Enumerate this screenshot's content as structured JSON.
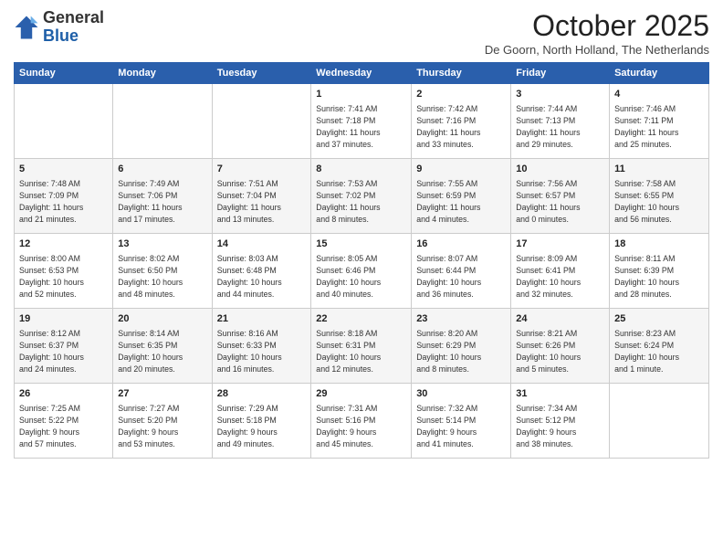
{
  "header": {
    "logo_general": "General",
    "logo_blue": "Blue",
    "month_title": "October 2025",
    "subtitle": "De Goorn, North Holland, The Netherlands"
  },
  "columns": [
    "Sunday",
    "Monday",
    "Tuesday",
    "Wednesday",
    "Thursday",
    "Friday",
    "Saturday"
  ],
  "weeks": [
    [
      {
        "day": "",
        "info": ""
      },
      {
        "day": "",
        "info": ""
      },
      {
        "day": "",
        "info": ""
      },
      {
        "day": "1",
        "info": "Sunrise: 7:41 AM\nSunset: 7:18 PM\nDaylight: 11 hours\nand 37 minutes."
      },
      {
        "day": "2",
        "info": "Sunrise: 7:42 AM\nSunset: 7:16 PM\nDaylight: 11 hours\nand 33 minutes."
      },
      {
        "day": "3",
        "info": "Sunrise: 7:44 AM\nSunset: 7:13 PM\nDaylight: 11 hours\nand 29 minutes."
      },
      {
        "day": "4",
        "info": "Sunrise: 7:46 AM\nSunset: 7:11 PM\nDaylight: 11 hours\nand 25 minutes."
      }
    ],
    [
      {
        "day": "5",
        "info": "Sunrise: 7:48 AM\nSunset: 7:09 PM\nDaylight: 11 hours\nand 21 minutes."
      },
      {
        "day": "6",
        "info": "Sunrise: 7:49 AM\nSunset: 7:06 PM\nDaylight: 11 hours\nand 17 minutes."
      },
      {
        "day": "7",
        "info": "Sunrise: 7:51 AM\nSunset: 7:04 PM\nDaylight: 11 hours\nand 13 minutes."
      },
      {
        "day": "8",
        "info": "Sunrise: 7:53 AM\nSunset: 7:02 PM\nDaylight: 11 hours\nand 8 minutes."
      },
      {
        "day": "9",
        "info": "Sunrise: 7:55 AM\nSunset: 6:59 PM\nDaylight: 11 hours\nand 4 minutes."
      },
      {
        "day": "10",
        "info": "Sunrise: 7:56 AM\nSunset: 6:57 PM\nDaylight: 11 hours\nand 0 minutes."
      },
      {
        "day": "11",
        "info": "Sunrise: 7:58 AM\nSunset: 6:55 PM\nDaylight: 10 hours\nand 56 minutes."
      }
    ],
    [
      {
        "day": "12",
        "info": "Sunrise: 8:00 AM\nSunset: 6:53 PM\nDaylight: 10 hours\nand 52 minutes."
      },
      {
        "day": "13",
        "info": "Sunrise: 8:02 AM\nSunset: 6:50 PM\nDaylight: 10 hours\nand 48 minutes."
      },
      {
        "day": "14",
        "info": "Sunrise: 8:03 AM\nSunset: 6:48 PM\nDaylight: 10 hours\nand 44 minutes."
      },
      {
        "day": "15",
        "info": "Sunrise: 8:05 AM\nSunset: 6:46 PM\nDaylight: 10 hours\nand 40 minutes."
      },
      {
        "day": "16",
        "info": "Sunrise: 8:07 AM\nSunset: 6:44 PM\nDaylight: 10 hours\nand 36 minutes."
      },
      {
        "day": "17",
        "info": "Sunrise: 8:09 AM\nSunset: 6:41 PM\nDaylight: 10 hours\nand 32 minutes."
      },
      {
        "day": "18",
        "info": "Sunrise: 8:11 AM\nSunset: 6:39 PM\nDaylight: 10 hours\nand 28 minutes."
      }
    ],
    [
      {
        "day": "19",
        "info": "Sunrise: 8:12 AM\nSunset: 6:37 PM\nDaylight: 10 hours\nand 24 minutes."
      },
      {
        "day": "20",
        "info": "Sunrise: 8:14 AM\nSunset: 6:35 PM\nDaylight: 10 hours\nand 20 minutes."
      },
      {
        "day": "21",
        "info": "Sunrise: 8:16 AM\nSunset: 6:33 PM\nDaylight: 10 hours\nand 16 minutes."
      },
      {
        "day": "22",
        "info": "Sunrise: 8:18 AM\nSunset: 6:31 PM\nDaylight: 10 hours\nand 12 minutes."
      },
      {
        "day": "23",
        "info": "Sunrise: 8:20 AM\nSunset: 6:29 PM\nDaylight: 10 hours\nand 8 minutes."
      },
      {
        "day": "24",
        "info": "Sunrise: 8:21 AM\nSunset: 6:26 PM\nDaylight: 10 hours\nand 5 minutes."
      },
      {
        "day": "25",
        "info": "Sunrise: 8:23 AM\nSunset: 6:24 PM\nDaylight: 10 hours\nand 1 minute."
      }
    ],
    [
      {
        "day": "26",
        "info": "Sunrise: 7:25 AM\nSunset: 5:22 PM\nDaylight: 9 hours\nand 57 minutes."
      },
      {
        "day": "27",
        "info": "Sunrise: 7:27 AM\nSunset: 5:20 PM\nDaylight: 9 hours\nand 53 minutes."
      },
      {
        "day": "28",
        "info": "Sunrise: 7:29 AM\nSunset: 5:18 PM\nDaylight: 9 hours\nand 49 minutes."
      },
      {
        "day": "29",
        "info": "Sunrise: 7:31 AM\nSunset: 5:16 PM\nDaylight: 9 hours\nand 45 minutes."
      },
      {
        "day": "30",
        "info": "Sunrise: 7:32 AM\nSunset: 5:14 PM\nDaylight: 9 hours\nand 41 minutes."
      },
      {
        "day": "31",
        "info": "Sunrise: 7:34 AM\nSunset: 5:12 PM\nDaylight: 9 hours\nand 38 minutes."
      },
      {
        "day": "",
        "info": ""
      }
    ]
  ]
}
